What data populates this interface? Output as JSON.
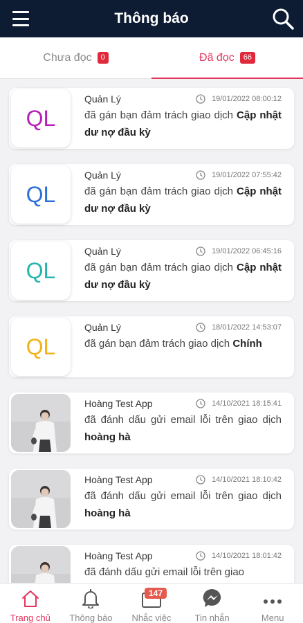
{
  "header": {
    "title": "Thông báo"
  },
  "tabs": [
    {
      "label": "Chưa đọc",
      "count": "0"
    },
    {
      "label": "Đã đọc",
      "count": "66"
    }
  ],
  "notifications": [
    {
      "sender": "Quản Lý",
      "time": "19/01/2022 08:00:12",
      "text": "đã gán bạn đảm trách giao dịch",
      "subject": "Cập nhật dư nợ đầu kỳ",
      "avatar_text": "QL",
      "avatar_color": "#b522b9"
    },
    {
      "sender": "Quản Lý",
      "time": "19/01/2022 07:55:42",
      "text": "đã gán bạn đảm trách giao dịch",
      "subject": "Cập nhật dư nợ đầu kỳ",
      "avatar_text": "QL",
      "avatar_color": "#2d6fd8"
    },
    {
      "sender": "Quản Lý",
      "time": "19/01/2022 06:45:16",
      "text": "đã gán bạn đảm trách giao dịch",
      "subject": "Cập nhật dư nợ đầu kỳ",
      "avatar_text": "QL",
      "avatar_color": "#26b4ad"
    },
    {
      "sender": "Quản Lý",
      "time": "18/01/2022 14:53:07",
      "text": "đã gán bạn đảm trách giao dịch",
      "subject": "Chính",
      "avatar_text": "QL",
      "avatar_color": "#f1b21b"
    },
    {
      "sender": "Hoàng Test App",
      "time": "14/10/2021 18:15:41",
      "text": "đã đánh dấu gửi email lỗi trên giao dịch",
      "subject": "hoàng hà",
      "avatar_text": "",
      "avatar_color": ""
    },
    {
      "sender": "Hoàng Test App",
      "time": "14/10/2021 18:10:42",
      "text": "đã đánh dấu gửi email lỗi trên giao dịch",
      "subject": "hoàng hà",
      "avatar_text": "",
      "avatar_color": ""
    },
    {
      "sender": "Hoàng Test App",
      "time": "14/10/2021 18:01:42",
      "text": "đã đánh dấu gửi email lỗi trên giao",
      "subject": "",
      "avatar_text": "",
      "avatar_color": ""
    }
  ],
  "bottom_nav": [
    {
      "label": "Trang chủ",
      "icon": "home-icon",
      "active": true
    },
    {
      "label": "Thông báo",
      "icon": "bell-icon"
    },
    {
      "label": "Nhắc việc",
      "icon": "task-icon",
      "badge": "147"
    },
    {
      "label": "Tin nhắn",
      "icon": "messenger-icon"
    },
    {
      "label": "Menu",
      "icon": "more-icon"
    }
  ],
  "colors": {
    "header_bg": "#0d1b33",
    "accent": "#e3365e",
    "badge": "#e02a3c"
  }
}
